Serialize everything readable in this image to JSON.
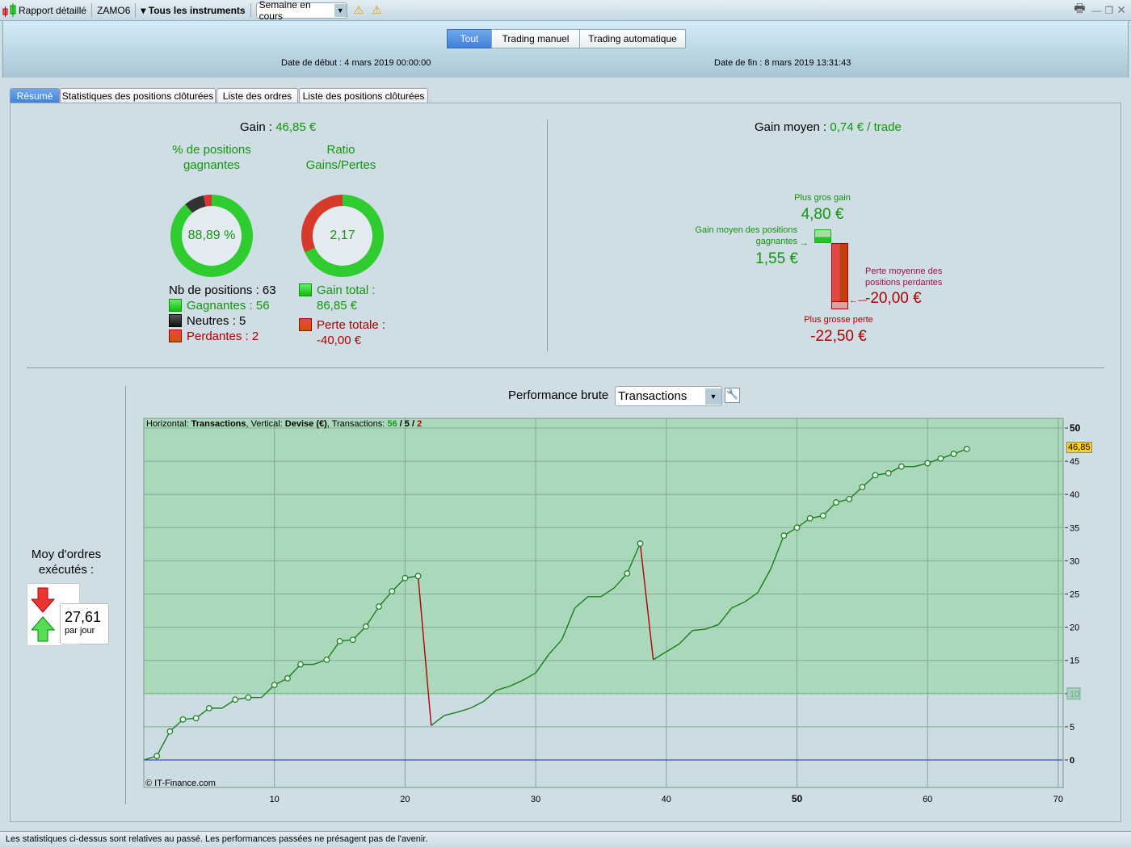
{
  "toolbar": {
    "title": "Rapport détaillé",
    "account": "ZAMO6",
    "instruments": "Tous les instruments",
    "period": "Semaine en cours",
    "icons": [
      "candlestick-icon",
      "warning-icon",
      "warning-icon",
      "printer-icon",
      "minimize-icon",
      "restore-icon",
      "close-icon"
    ]
  },
  "header": {
    "modes": [
      "Tout",
      "Trading manuel",
      "Trading automatique"
    ],
    "active_mode": "Tout",
    "start_label": "Date de début :",
    "start_value": "4 mars 2019 00:00:00",
    "end_label": "Date de fin :",
    "end_value": "8 mars 2019 13:31:43"
  },
  "tabs": [
    "Résumé",
    "Statistiques des positions clôturées",
    "Liste des ordres",
    "Liste des positions clôturées"
  ],
  "summary": {
    "gain_label": "Gain :",
    "gain_value": "46,85 €",
    "win_title": "% de positions gagnantes",
    "win_value": "88,89 %",
    "ratio_title": "Ratio Gains/Pertes",
    "ratio_value": "2,17",
    "positions_label": "Nb de positions : 63",
    "winners": "Gagnantes : 56",
    "neutral": "Neutres : 5",
    "losers": "Perdantes : 2",
    "counts": {
      "win": 56,
      "neutral": 5,
      "loss": 2
    },
    "gain_total_label": "Gain total :",
    "gain_total_value": "86,85 €",
    "loss_total_label": "Perte totale :",
    "loss_total_value": "-40,00 €",
    "totals": {
      "gain": 86.85,
      "loss": 40.0
    },
    "avg_label": "Gain moyen :",
    "avg_value": "0,74 € / trade",
    "best_label": "Plus gros gain",
    "best_value": "4,80 €",
    "avg_win_label": "Gain moyen des positions gagnantes",
    "avg_win_value": "1,55 €",
    "avg_loss_label": "Perte moyenne des positions perdantes",
    "avg_loss_value": "-20,00 €",
    "worst_label": "Plus grosse perte",
    "worst_value": "-22,50 €"
  },
  "orders": {
    "label": "Moy d'ordres exécutés :",
    "value": "27,61",
    "unit": "par jour"
  },
  "perf": {
    "label": "Performance brute",
    "select": "Transactions"
  },
  "chart_data": {
    "type": "line",
    "info_prefix": "Horizontal: ",
    "info_h": "Transactions",
    "info_mid": ", Vertical: ",
    "info_v": "Devise (€)",
    "info_tx": ", Transactions: ",
    "info_win": "56",
    "info_neu": "5",
    "info_loss": "2",
    "copyright": "© IT-Finance.com",
    "xlim": [
      0,
      70
    ],
    "ylim": [
      -4,
      51
    ],
    "xticks": [
      10,
      20,
      30,
      40,
      50,
      60,
      70
    ],
    "yticks": [
      0,
      5,
      10,
      15,
      20,
      25,
      30,
      35,
      40,
      45,
      50
    ],
    "reference_level": 10,
    "last_value_label": "46,85",
    "y": [
      0,
      0.6,
      4.3,
      6.1,
      6.3,
      7.8,
      7.8,
      9.1,
      9.4,
      9.4,
      11.3,
      12.3,
      14.4,
      14.4,
      15.1,
      17.9,
      18.1,
      20.1,
      23.1,
      25.4,
      27.4,
      27.7,
      5.2,
      6.7,
      7.2,
      7.8,
      8.8,
      10.5,
      11.1,
      12.0,
      13.1,
      15.9,
      18.1,
      22.9,
      24.6,
      24.6,
      25.9,
      28.1,
      32.6,
      15.1,
      16.3,
      17.5,
      19.5,
      19.7,
      20.4,
      22.9,
      23.8,
      25.2,
      28.8,
      33.8,
      35.0,
      36.4,
      36.8,
      38.8,
      39.3,
      41.1,
      42.9,
      43.2,
      44.2,
      44.2,
      44.7,
      45.4,
      46.1,
      46.85
    ],
    "markers": [
      1,
      2,
      3,
      4,
      5,
      7,
      8,
      10,
      11,
      12,
      14,
      15,
      16,
      17,
      18,
      19,
      20,
      21,
      37,
      38,
      49,
      50,
      51,
      52,
      53,
      54,
      55,
      56,
      57,
      58,
      60,
      61,
      62,
      63
    ],
    "losing_segments": [
      22,
      39
    ],
    "colors": {
      "gain": "#1a7f1a",
      "loss": "#b00000",
      "positive_zone": "#a9d8bb",
      "negative_zone": "#cbdce3",
      "zero_line": "#2020c0"
    }
  },
  "footer": "Les statistiques ci-dessus sont relatives au passé. Les performances passées ne présagent pas de l'avenir."
}
